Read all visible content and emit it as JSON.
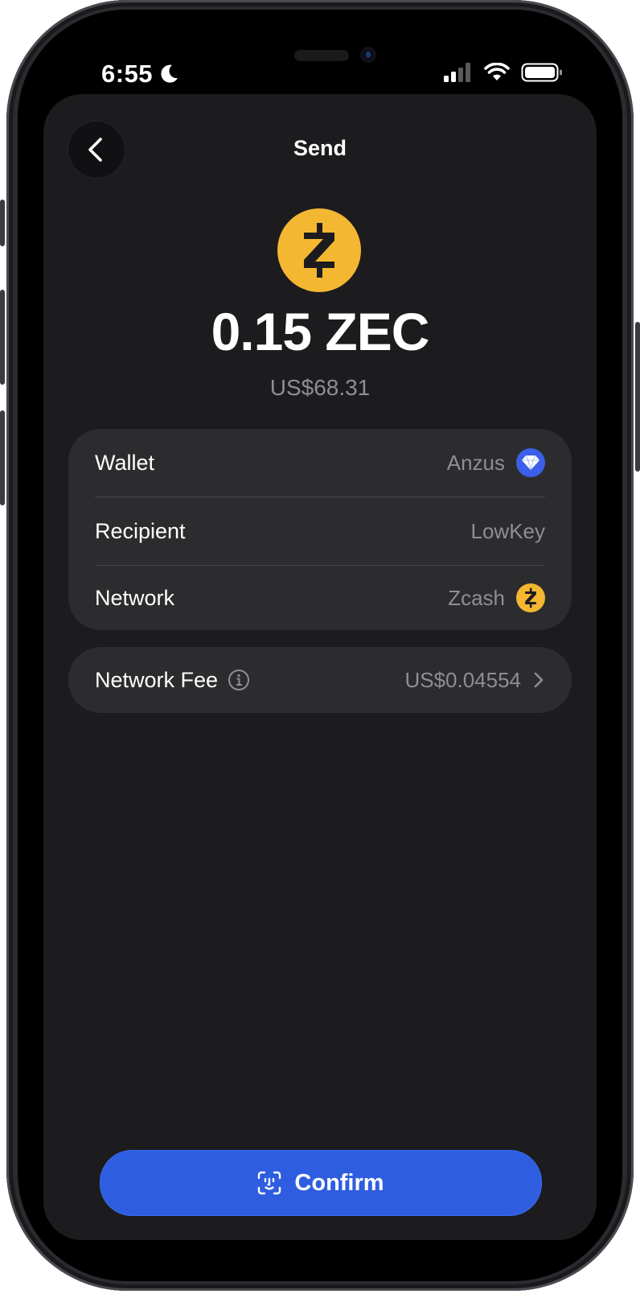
{
  "status_bar": {
    "time": "6:55"
  },
  "header": {
    "title": "Send"
  },
  "asset": {
    "amount": "0.15 ZEC",
    "fiat_value": "US$68.31",
    "coin_color": "#f4b731"
  },
  "details": {
    "wallet": {
      "label": "Wallet",
      "value": "Anzus",
      "icon": "wallet-diamond-icon"
    },
    "recipient": {
      "label": "Recipient",
      "value": "LowKey"
    },
    "network": {
      "label": "Network",
      "value": "Zcash",
      "icon": "zcash-icon"
    }
  },
  "fee": {
    "label": "Network Fee",
    "value": "US$0.04554"
  },
  "confirm": {
    "label": "Confirm",
    "color": "#2e5de0"
  }
}
